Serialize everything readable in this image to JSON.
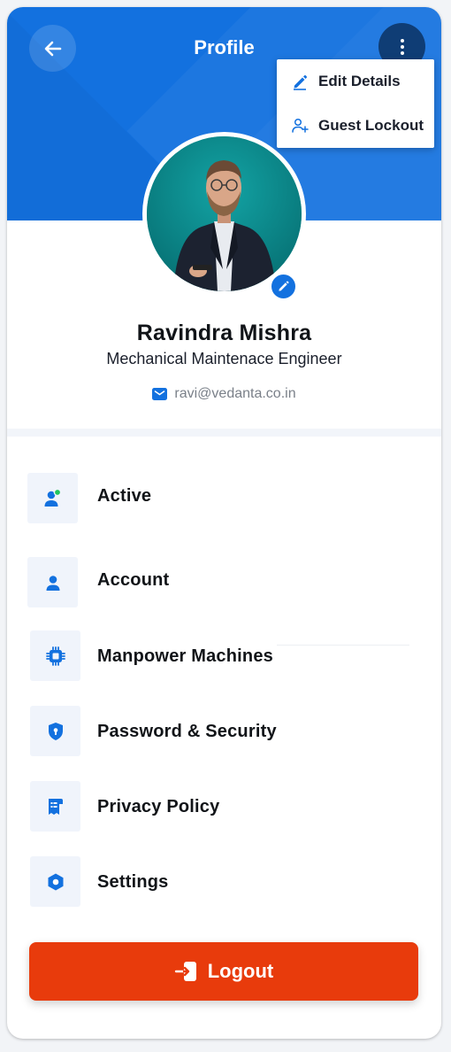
{
  "header": {
    "title": "Profile",
    "accent_color": "#1371df"
  },
  "menu": {
    "items": [
      {
        "label": "Edit Details",
        "icon": "pencil-icon"
      },
      {
        "label": "Guest Lockout",
        "icon": "user-plus-icon"
      }
    ]
  },
  "profile": {
    "name": "Ravindra Mishra",
    "role": "Mechanical Maintenace Engineer",
    "email": "ravi@vedanta.co.in"
  },
  "list": {
    "items": [
      {
        "label": "Active",
        "icon": "user-status-icon"
      },
      {
        "label": "Account",
        "icon": "user-icon"
      },
      {
        "label": "Manpower Machines",
        "icon": "chip-icon"
      },
      {
        "label": "Password & Security",
        "icon": "shield-lock-icon"
      },
      {
        "label": "Privacy Policy",
        "icon": "receipt-icon"
      },
      {
        "label": "Settings",
        "icon": "hexagon-gear-icon"
      }
    ]
  },
  "logout": {
    "label": "Logout",
    "color": "#e83b0c"
  }
}
